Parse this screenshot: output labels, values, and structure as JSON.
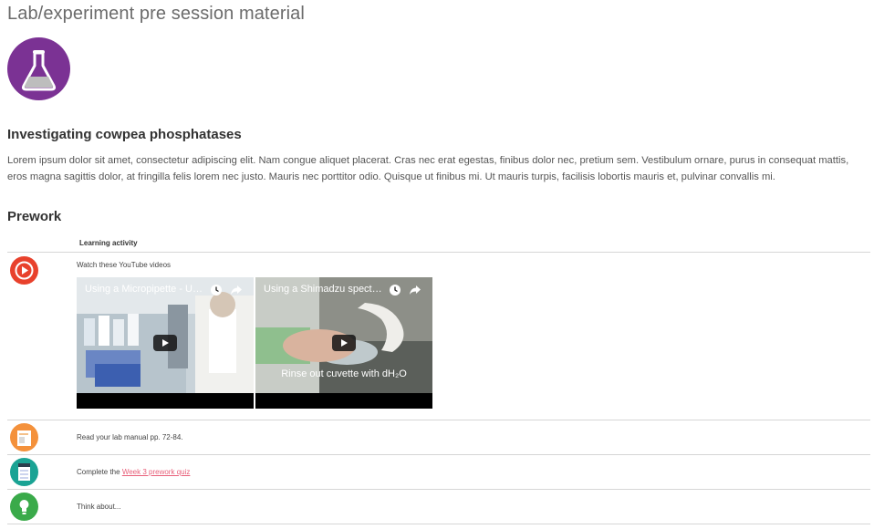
{
  "page": {
    "title": "Lab/experiment pre session material"
  },
  "experiment": {
    "heading": "Investigating cowpea phosphatases",
    "description": "Lorem ipsum dolor sit amet, consectetur adipiscing elit. Nam congue aliquet placerat. Cras nec erat egestas, finibus dolor nec, pretium sem. Vestibulum ornare, purus in consequat mattis, eros magna sagittis dolor, at fringilla felis lorem nec justo. Mauris nec porttitor odio. Quisque ut finibus mi. Ut mauris turpis, facilisis lobortis mauris et, pulvinar convallis mi.",
    "badge_icon": "flask-icon",
    "badge_color": "#7b3294"
  },
  "prework": {
    "heading": "Prework",
    "column_header": "Learning activity",
    "rows": [
      {
        "icon": "play-icon",
        "icon_color": "#e8412c",
        "text": "Watch these YouTube videos"
      },
      {
        "icon": "book-icon",
        "icon_color": "#f4913b",
        "text": "Read your lab manual pp. 72-84."
      },
      {
        "icon": "quiz-icon",
        "icon_color": "#1aa394",
        "text_before": "Complete the ",
        "link": "Week 3 prework quiz"
      },
      {
        "icon": "lightbulb-icon",
        "icon_color": "#3aaa4a",
        "text": "Think about..."
      }
    ],
    "videos": [
      {
        "title": "Using a Micropipette - Uni...",
        "caption": ""
      },
      {
        "title": "Using a Shimadzu spectro...",
        "caption": "Rinse out cuvette with dH₂O"
      }
    ]
  }
}
